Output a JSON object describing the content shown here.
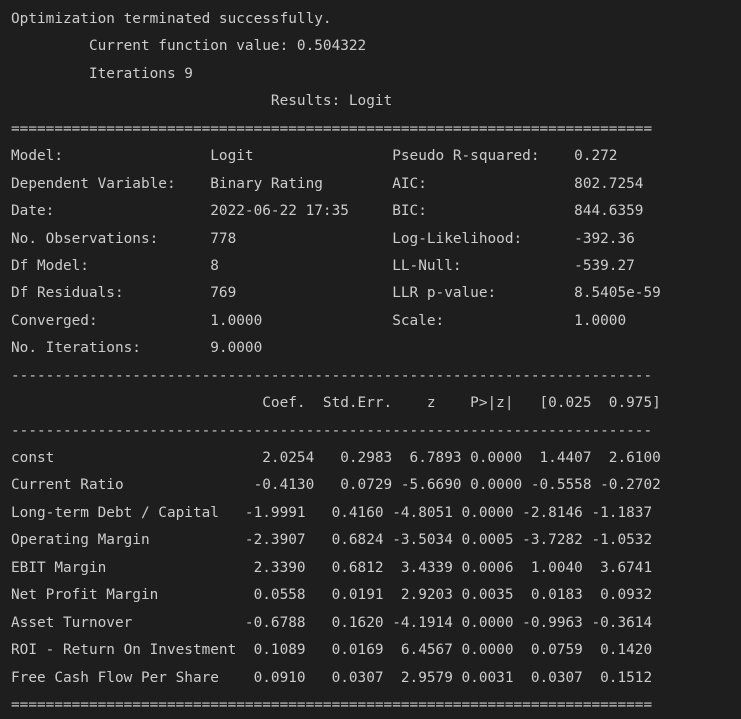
{
  "output_lines": [
    "Optimization terminated successfully.",
    "         Current function value: 0.504322",
    "         Iterations 9",
    "                              Results: Logit",
    "==========================================================================",
    "Model:                 Logit                Pseudo R-squared:    0.272",
    "Dependent Variable:    Binary Rating        AIC:                 802.7254",
    "Date:                  2022-06-22 17:35     BIC:                 844.6359",
    "No. Observations:      778                  Log-Likelihood:      -392.36",
    "Df Model:              8                    LL-Null:             -539.27",
    "Df Residuals:          769                  LLR p-value:         8.5405e-59",
    "Converged:             1.0000               Scale:               1.0000",
    "No. Iterations:        9.0000",
    "--------------------------------------------------------------------------",
    "                             Coef.  Std.Err.    z    P>|z|   [0.025  0.975]",
    "--------------------------------------------------------------------------",
    "const                        2.0254   0.2983  6.7893 0.0000  1.4407  2.6100",
    "Current Ratio               -0.4130   0.0729 -5.6690 0.0000 -0.5558 -0.2702",
    "Long-term Debt / Capital   -1.9991   0.4160 -4.8051 0.0000 -2.8146 -1.1837",
    "Operating Margin           -2.3907   0.6824 -3.5034 0.0005 -3.7282 -1.0532",
    "EBIT Margin                 2.3390   0.6812  3.4339 0.0006  1.0040  3.6741",
    "Net Profit Margin           0.0558   0.0191  2.9203 0.0035  0.0183  0.0932",
    "Asset Turnover             -0.6788   0.1620 -4.1914 0.0000 -0.9963 -0.3614",
    "ROI - Return On Investment  0.1089   0.0169  6.4567 0.0000  0.0759  0.1420",
    "Free Cash Flow Per Share    0.0910   0.0307  2.9579 0.0031  0.0307  0.1512",
    "=========================================================================="
  ]
}
